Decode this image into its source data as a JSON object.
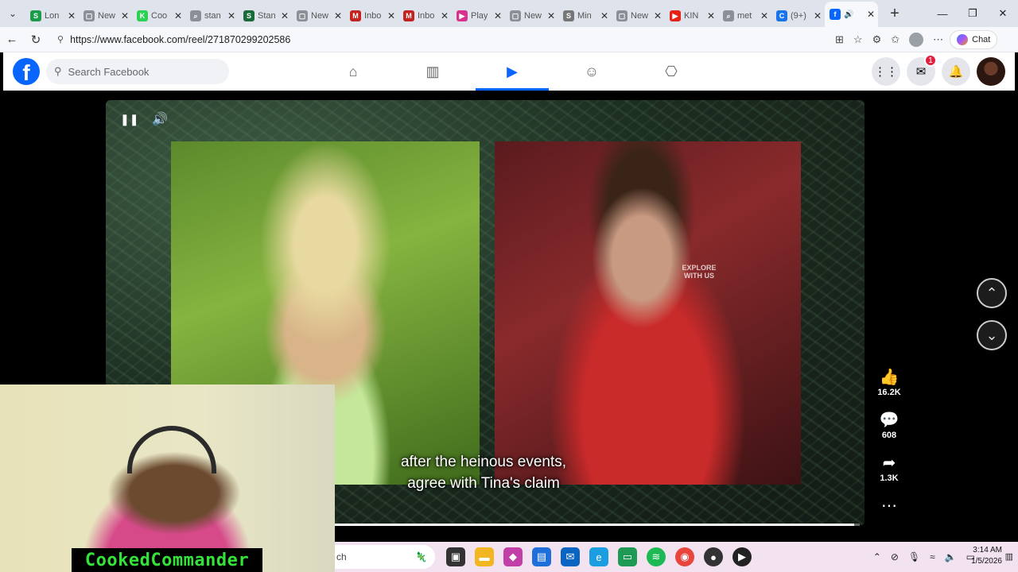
{
  "browser": {
    "tabs": [
      {
        "label": "Lon",
        "icon": "S",
        "color": "#1a9c4a"
      },
      {
        "label": "New",
        "icon": "▢",
        "color": "#8a8f98"
      },
      {
        "label": "Coo",
        "icon": "K",
        "color": "#2bd150"
      },
      {
        "label": "stan",
        "icon": "⌕",
        "color": "#8a8f98"
      },
      {
        "label": "Stan",
        "icon": "S",
        "color": "#1a6b3a"
      },
      {
        "label": "New",
        "icon": "▢",
        "color": "#8a8f98"
      },
      {
        "label": "Inbo",
        "icon": "M",
        "color": "#c5221f"
      },
      {
        "label": "Inbo",
        "icon": "M",
        "color": "#c5221f"
      },
      {
        "label": "Play",
        "icon": "▶",
        "color": "#d6338d"
      },
      {
        "label": "New",
        "icon": "▢",
        "color": "#8a8f98"
      },
      {
        "label": "Min",
        "icon": "S",
        "color": "#777"
      },
      {
        "label": "New",
        "icon": "▢",
        "color": "#8a8f98"
      },
      {
        "label": "KIN",
        "icon": "▶",
        "color": "#e62117"
      },
      {
        "label": "met",
        "icon": "⌕",
        "color": "#8a8f98"
      },
      {
        "label": "(9+)",
        "icon": "C",
        "color": "#1a73e8"
      },
      {
        "label": "",
        "icon": "f",
        "color": "#0866ff",
        "active": true
      }
    ],
    "url": "https://www.facebook.com/reel/271870299202586",
    "chat_label": "Chat"
  },
  "facebook": {
    "logo": "f",
    "search_placeholder": "Search Facebook",
    "notifications_badge": "1"
  },
  "reel": {
    "caption_line1": "after the heinous events,",
    "caption_line2": "agree with Tina's claim",
    "watermark": "EXPLORE WITH US",
    "progress": 0.99,
    "likes": "16.2K",
    "comments": "608",
    "shares": "1.3K"
  },
  "webcam": {
    "streamer_name": "CookedCommander"
  },
  "taskbar": {
    "search_text": "ch",
    "time": "3:14 AM",
    "date": "1/5/2026"
  }
}
